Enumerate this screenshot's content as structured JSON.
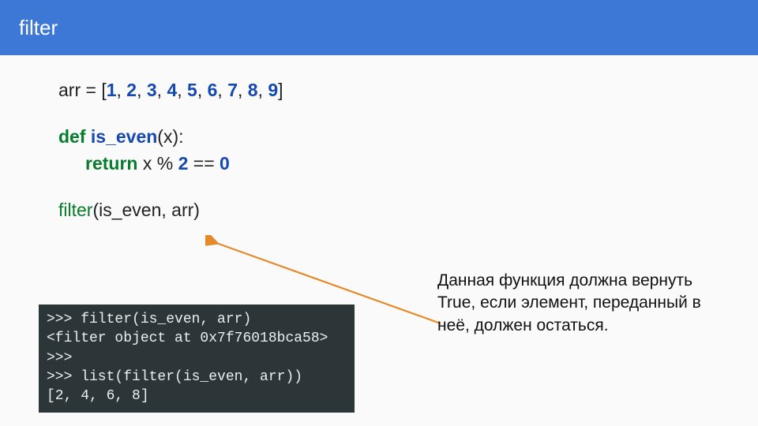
{
  "header": {
    "title": "filter"
  },
  "code": {
    "arr_lead": "arr = [",
    "arr_nums": [
      "1",
      "2",
      "3",
      "4",
      "5",
      "6",
      "7",
      "8",
      "9"
    ],
    "arr_tail": "]",
    "def_kw": "def ",
    "fn_name": "is_even",
    "def_tail": "(x):",
    "return_kw": "return",
    "return_mid_a": " x % ",
    "mod_num": "2",
    "return_mid_b": " == ",
    "zero_num": "0",
    "call_name": "filter",
    "call_tail": "(is_even, arr)"
  },
  "note": {
    "text": "Данная функция должна вернуть True, если элемент, переданный в неё, должен остаться."
  },
  "terminal": {
    "l1": ">>> filter(is_even, arr)",
    "l2": "<filter object at 0x7f76018bca58>",
    "l3": ">>>",
    "l4": ">>> list(filter(is_even, arr))",
    "l5": "[2, 4, 6, 8]"
  },
  "arrow": {
    "color": "#e58a2a"
  }
}
